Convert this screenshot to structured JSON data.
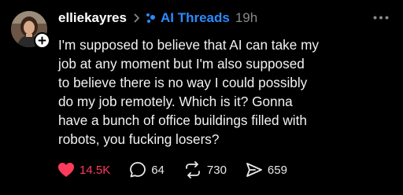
{
  "post": {
    "username": "elliekayres",
    "community": {
      "name": "AI Threads",
      "color": "#2a8cff",
      "icon": "sparkle-dots-icon"
    },
    "timestamp": "19h",
    "text": "I'm supposed to believe that AI can take my\njob at any moment but I'm also supposed\nto believe there is no way I could possibly\ndo my job remotely. Which is it? Gonna\nhave a bunch of office buildings filled with\nrobots, you fucking losers?",
    "actions": {
      "likes": "14.5K",
      "replies": "64",
      "reposts": "730",
      "shares": "659"
    },
    "like_color": "#ff3b5c"
  }
}
